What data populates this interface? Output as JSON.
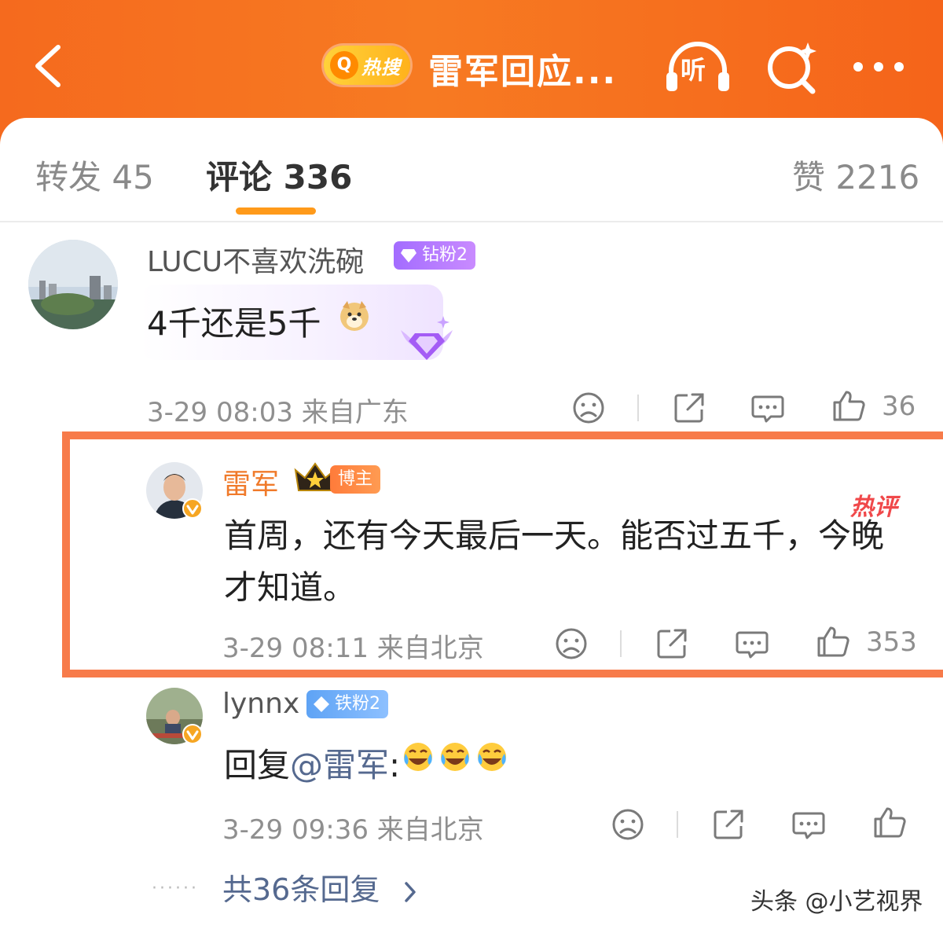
{
  "header": {
    "hot_badge_label": "热搜",
    "title": "雷军回应...",
    "listen_label": "听"
  },
  "tabs": [
    {
      "label": "转发 45"
    },
    {
      "label": "评论 336"
    },
    {
      "label": "赞 2216"
    }
  ],
  "comments": [
    {
      "username": "LUCU不喜欢洗碗",
      "badge": "钻粉2",
      "text_before_emoji": "4千还是5千",
      "meta": "3-29 08:03  来自广东",
      "likes": "36"
    },
    {
      "username": "雷军",
      "badge": "博主",
      "hot_tag": "热评",
      "text_line1": "首周，还有今天最后一天。能否过五千，今晚",
      "text_line2": "才知道。",
      "meta": "3-29 08:11  来自北京",
      "likes": "353"
    },
    {
      "username": "lynnx",
      "badge": "铁粉2",
      "text_prefix": "回复",
      "mention": "@雷军",
      "text_suffix": ":",
      "meta": "3-29 09:36  来自北京"
    }
  ],
  "reply_link": "共36条回复",
  "watermark": "头条 @小艺视界",
  "colors": {
    "header_orange": "#f56a1e",
    "tab_indicator": "#ff9a1a",
    "highlight_border": "#f77b4a",
    "blogger_name": "#f07a2a",
    "mention_blue": "#55698f"
  }
}
